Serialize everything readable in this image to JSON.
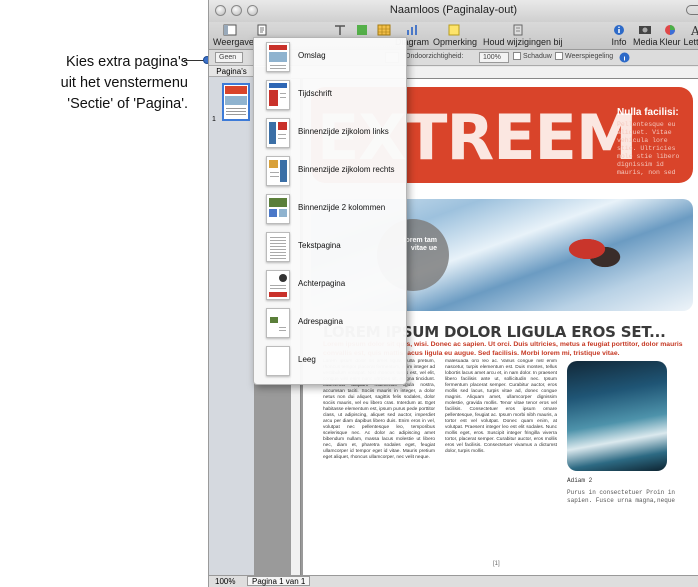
{
  "callout": {
    "lines": [
      "Kies extra pagina's",
      "uit het venstermenu",
      "'Sectie' of 'Pagina'."
    ]
  },
  "window": {
    "title": "Naamloos (Paginalay-out)"
  },
  "toolbar": {
    "items": [
      {
        "label": "Weergave",
        "icon": "view-icon"
      },
      {
        "label": "",
        "icon": "page-section-icon"
      },
      {
        "label": "Diagram",
        "icon": "chart-icon"
      },
      {
        "label": "Opmerking",
        "icon": "comment-icon"
      },
      {
        "label": "Houd wijzigingen bij",
        "icon": "track-changes-icon"
      },
      {
        "label": "Info",
        "icon": "info-icon"
      },
      {
        "label": "Media",
        "icon": "media-icon"
      },
      {
        "label": "Kleur",
        "icon": "color-icon"
      },
      {
        "label": "Letter",
        "icon": "font-icon"
      }
    ]
  },
  "formatbar": {
    "geen": "Geen",
    "opacity_label": "Ondoorzichtigheid:",
    "opacity_value": "100%",
    "shadow": "Schaduw",
    "reflection": "Weerspiegeling"
  },
  "sidebar": {
    "header": "Pagina's",
    "page_number": "1"
  },
  "menu": {
    "items": [
      {
        "label": "Omslag",
        "accent": "#c9312a"
      },
      {
        "label": "Tijdschrift",
        "accent": "#2e67b5"
      },
      {
        "label": "Binnenzijde zijkolom links",
        "accent": "#3b6fa6"
      },
      {
        "label": "Binnenzijde zijkolom rechts",
        "accent": "#3b6fa6"
      },
      {
        "label": "Binnenzijde 2 kolommen",
        "accent": "#5b7f3a"
      },
      {
        "label": "Tekstpagina",
        "accent": "#888888"
      },
      {
        "label": "Achterpagina",
        "accent": "#c9312a"
      },
      {
        "label": "Adrespagina",
        "accent": "#5b7f3a"
      },
      {
        "label": "Leeg",
        "accent": "#ffffff"
      }
    ]
  },
  "document": {
    "hero_word": "EXTREEM",
    "aside_title": "Nulla facilisi:",
    "aside_text": "Pellentesque eu aliquet. Vitae vehicula lore stie. Ultricies mole stie libero dignissim id mauris, non sed",
    "circle_text": "lorem tam vitae ue",
    "headline": "LOREM IPSUM DOLOR LIGULA EROS SET...",
    "subhead": "Lorem ipsum dolor sit quis, wisi. Donec ac sapien. Ut orci. Duis ultricies, metus a feugiat porttitor, dolor mauris convallis est, quis mattis lacus ligula eu augue. Sed facilisis. Morbi lorem mi, tristique vitae.",
    "col1": "Lorem ipsum dolor sit amet ligula nulla pretium, rhoncus tempor placerat fermentum, enim integer ad vestibulum volutpat. Nisl rhoncus turpis est, vel elit, congue wisi enim nunc ultricies sit, magna tincidunt. Maecenas aliquam maecenas ligula nostra, accumsan taciti. Sociis mauris in integer, a dolor netus non dui aliquet, sagittis felis sodales, dolor sociis mauris, vel eu libero cras. Interdum at. Eget habitasse elementum est, ipsum purus pede porttitor class, ut adipiscing, aliquet sed auctor, imperdiet arcu per diam dapibus libero duis. Enim eros in vel, volutpat nec pellentesque leo, temporibus scelerisque nec. Ac dolor ac adipiscing amet bibendum nullam, massa lacus molestie ut libero nec, diam et, pharetra sodales eget, feugiat ullamcorper id tempor eget id vitae. Mauris pretium eget aliquet, rhoncus ullamcorper, nec velit neque.",
    "col2": "malesuada orci leo ac. Varius congue nisl enim nascetur, turpis elementum est. Duis montes, tellus lobortis lacus amet arcu et, in nam dolor. In praesent libero facilisis ante ut, sollicitudin nec. Ipsum fermentum placerat semper. Curabitur auctor, eros mollis sed lacus, turpis vitae ad, donec congue magnis. Aliquam amet, ullamcorper dignissim molestie, gravida mollis. Tenor vitae tenor eros vel facilisis. Consectetuer eros ipsum ornare pellentesque, feugiat ac. Ipsum morbi nibh mauris, a tortor est vel volutpat. Donec quam enim, at volutpat. Praesent integer leo est elit sodales. Nunc mollis eget, eros. Suscipit integer fringilla viverra tortor, placerat semper. Curabitur auctor, eros mollis eros vel facilisis. Consectetuer vivamus a dictumst dolor, turpis mollis.",
    "caption_title": "Adiam 2",
    "caption_text": "Purus in consectetuer Proin in sapien. Fusce urna magna,neque",
    "page_label": "[1]"
  },
  "statusbar": {
    "zoom": "100%",
    "pages": "Pagina 1 van 1"
  },
  "colors": {
    "hero": "#d9442a",
    "selection": "#3d7bd8"
  }
}
